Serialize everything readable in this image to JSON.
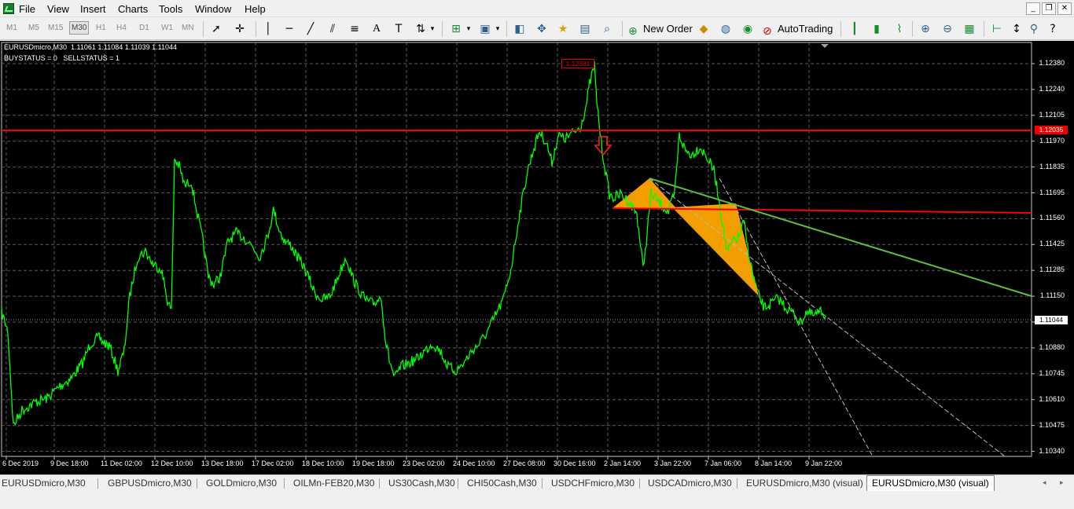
{
  "menu": [
    "File",
    "View",
    "Insert",
    "Charts",
    "Tools",
    "Window",
    "Help"
  ],
  "toolbar": {
    "timeframes": [
      "M1",
      "M5",
      "M15",
      "M30",
      "H1",
      "H4",
      "D1",
      "W1",
      "MN"
    ],
    "selected_timeframe": "M30",
    "new_order_label": "New Order",
    "autotrading_label": "AutoTrading"
  },
  "chart": {
    "symbol_line": "EURUSDmicro,M30  1.11061 1.11084 1.11039 1.11044",
    "status_line": "BUYSTATUS = 0   SELLSTATUS = 1",
    "price_levels": [
      "1.12380",
      "1.12240",
      "1.12105",
      "1.11970",
      "1.11835",
      "1.11695",
      "1.11560",
      "1.11425",
      "1.11285",
      "1.11150",
      "1.11015",
      "1.10880",
      "1.10745",
      "1.10610",
      "1.10475",
      "1.10340"
    ],
    "resistance_tag": "1.12035",
    "current_price_tag": "1.11044",
    "peak_tag": "1.12381",
    "time_labels": [
      "6 Dec 2019",
      "9 Dec 18:00",
      "11 Dec 02:00",
      "12 Dec 10:00",
      "13 Dec 18:00",
      "17 Dec 02:00",
      "18 Dec 10:00",
      "19 Dec 18:00",
      "23 Dec 02:00",
      "24 Dec 10:00",
      "27 Dec 08:00",
      "30 Dec 16:00",
      "2 Jan 14:00",
      "3 Jan 22:00",
      "7 Jan 06:00",
      "8 Jan 14:00",
      "9 Jan 22:00"
    ],
    "colors": {
      "background": "#000000",
      "price_line": "#00ff00",
      "resistance": "#ff0000",
      "trendline": "#5cbf3a",
      "pattern": "#ffa500"
    }
  },
  "tabs": [
    "EURUSDmicro,M30",
    "GBPUSDmicro,M30",
    "GOLDmicro,M30",
    "OILMn-FEB20,M30",
    "US30Cash,M30",
    "CHI50Cash,M30",
    "USDCHFmicro,M30",
    "USDCADmicro,M30",
    "EURUSDmicro,M30 (visual)",
    "EURUSDmicro,M30 (visual)"
  ],
  "active_tab_index": 9
}
